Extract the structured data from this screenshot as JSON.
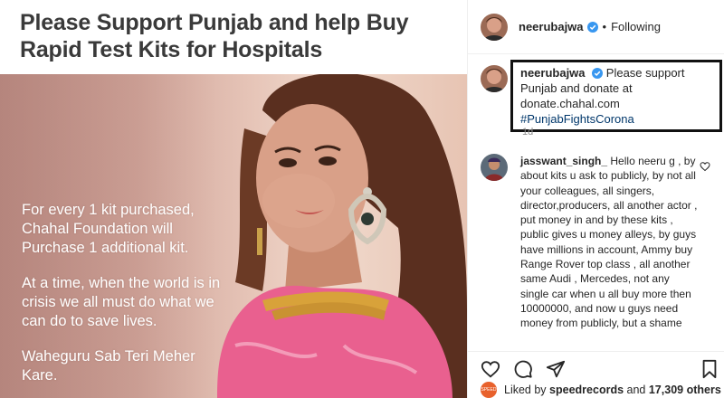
{
  "post_image": {
    "headline_line1": "Please Support Punjab and help Buy",
    "headline_line2": "Rapid Test Kits for Hospitals",
    "para1": "For every 1 kit purchased, Chahal Foundation will Purchase 1 additional kit.",
    "para2": "At a time, when the world is in crisis we all must do what we can do to save lives.",
    "para3": "Waheguru Sab Teri Meher Kare."
  },
  "header": {
    "username": "neerubajwa",
    "separator": "•",
    "follow_status": "Following"
  },
  "caption": {
    "username": "neerubajwa",
    "text": "Please support Punjab and donate at donate.chahal.com",
    "hashtag": "#PunjabFightsCorona",
    "time": "1d"
  },
  "comment": {
    "username": "jasswant_singh_",
    "text": "Hello neeru g , by about kits u ask to publicly, by not all your colleagues, all singers, director,producers, all another actor , put money in and by these kits , public gives u money alleys, by guys have millions in account, Ammy buy Range Rover top class , all another same Audi , Mercedes, not any single car when u all buy more then 10000000, and now u guys need money from publicly, but a shame"
  },
  "likes": {
    "prefix": "Liked by",
    "user": "speedrecords",
    "conjunction": "and",
    "count": "17,309 others",
    "avatar_text": "SPEED"
  },
  "icons": [
    "verified-badge-icon",
    "heart-icon",
    "comment-icon",
    "share-icon",
    "bookmark-icon"
  ],
  "colors": {
    "accent_blue": "#3897f0",
    "hashtag": "#00376b",
    "highlight_box": "#111111"
  }
}
